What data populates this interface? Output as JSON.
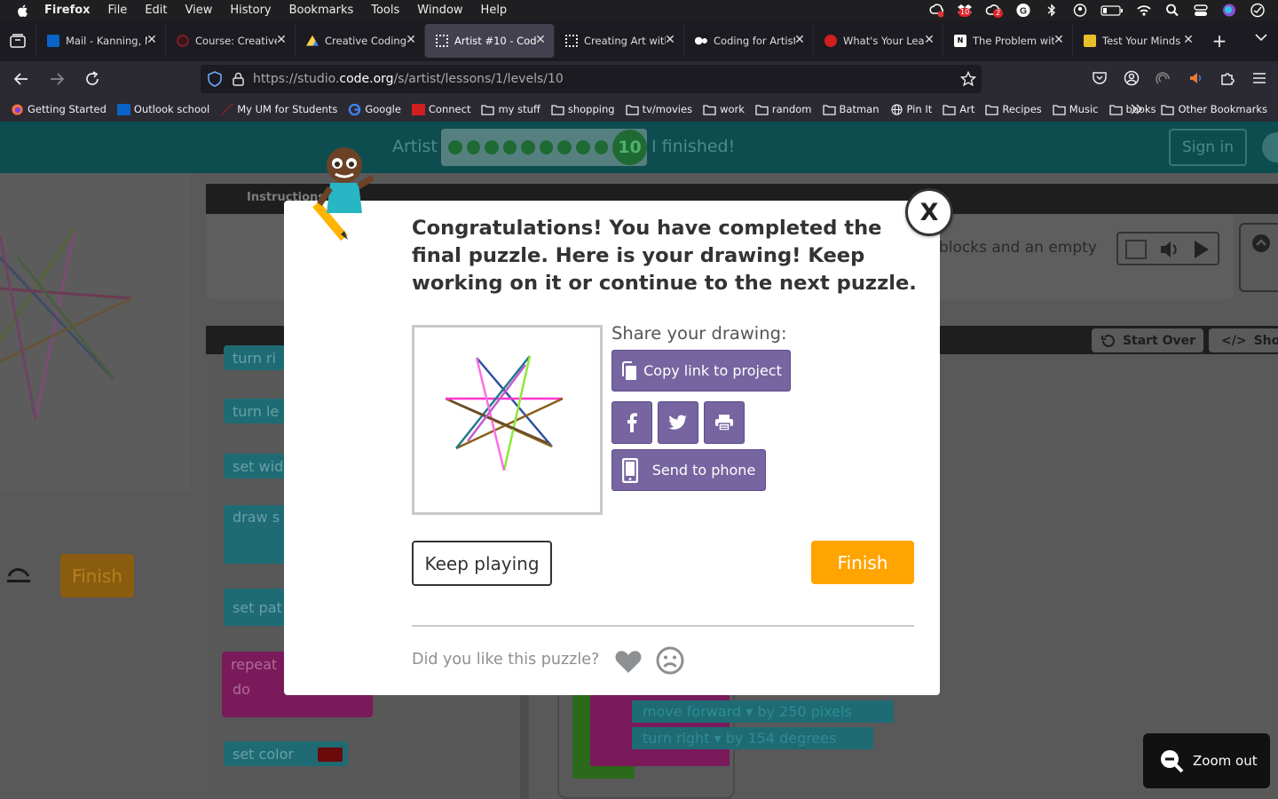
{
  "menubar": {
    "app": "Firefox",
    "items": [
      "File",
      "Edit",
      "View",
      "History",
      "Bookmarks",
      "Tools",
      "Window",
      "Help"
    ],
    "badge_count": "10",
    "badge_count2": "2"
  },
  "tabs": [
    {
      "title": "Mail - Kanning, N",
      "color": "#0a64c8",
      "active": false
    },
    {
      "title": "Course: Creative",
      "color": "#7a1f2a",
      "active": false
    },
    {
      "title": "Creative Coding",
      "color": "#3a7fd6",
      "active": false
    },
    {
      "title": "Artist #10 - Code",
      "color": "#ffffff",
      "active": true
    },
    {
      "title": "Creating Art with",
      "color": "#ffffff",
      "active": false
    },
    {
      "title": "Coding for Artist",
      "color": "#ffffff",
      "active": false
    },
    {
      "title": "What's Your Lea",
      "color": "#d11f1f",
      "active": false
    },
    {
      "title": "The Problem with",
      "color": "#ffffff",
      "active": false
    },
    {
      "title": "Test Your Minds",
      "color": "#e8c12a",
      "active": false
    }
  ],
  "url": {
    "prefix": "https://studio.",
    "domain": "code.org",
    "path": "/s/artist/lessons/1/levels/10"
  },
  "bookmarks": [
    "Getting Started",
    "Outlook school",
    "My UM for Students",
    "Google",
    "Connect",
    "my stuff",
    "shopping",
    "tv/movies",
    "work",
    "random",
    "Batman",
    "Pin It",
    "Art",
    "Recipes",
    "Music",
    "books"
  ],
  "other_bookmarks": "Other Bookmarks",
  "app_header": {
    "title": "Artist",
    "level": "10",
    "finished": "I finished!",
    "sign_in": "Sign in"
  },
  "workspace": {
    "instructions_tab": "Instructions",
    "instruction_text": "blocks and an empty",
    "start_over": "Start Over",
    "show_code": "Show",
    "finish": "Finish",
    "toolbox_blocks": [
      "turn ri",
      "turn le",
      "set wid",
      "draw s",
      "set pat",
      "repeat",
      "do",
      "set color"
    ],
    "code_line1": "move  forward ▾  by  250  pixels",
    "code_line2": "turn  right ▾  by  154  degrees",
    "zoom_out": "Zoom out"
  },
  "modal": {
    "close": "X",
    "message": "Congratulations! You have completed the final puzzle. Here is your drawing! Keep working on it or continue to the next puzzle.",
    "share_label": "Share your drawing:",
    "copy_link": "Copy link to project",
    "send_to_phone": "Send to phone",
    "keep_playing": "Keep playing",
    "finish": "Finish",
    "feedback_question": "Did you like this puzzle?"
  },
  "colors": {
    "finish": "#ffa400",
    "share_button": "#7665a0",
    "header": "#0e4d4f"
  }
}
